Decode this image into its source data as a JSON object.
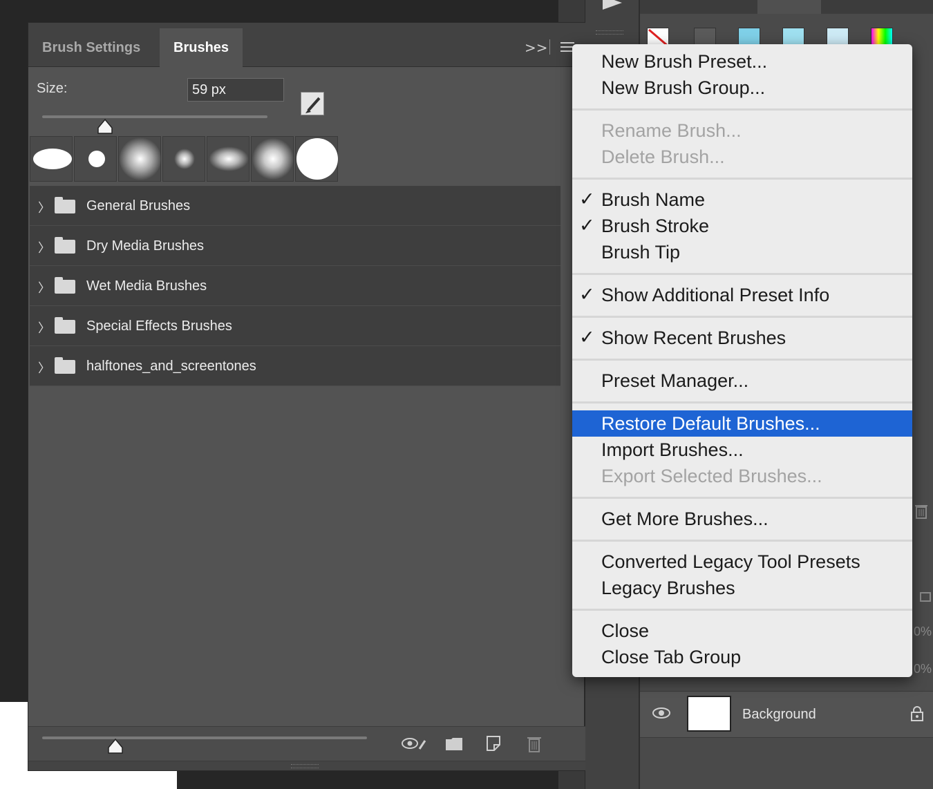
{
  "tabs": {
    "brush_settings": "Brush Settings",
    "brushes": "Brushes"
  },
  "size": {
    "label": "Size:",
    "value": "59 px",
    "slider_fraction": 0.28
  },
  "groups": [
    {
      "label": "General Brushes"
    },
    {
      "label": "Dry Media Brushes"
    },
    {
      "label": "Wet Media Brushes"
    },
    {
      "label": "Special Effects Brushes"
    },
    {
      "label": "halftones_and_screentones"
    }
  ],
  "menu": {
    "new_brush_preset": "New Brush Preset...",
    "new_brush_group": "New Brush Group...",
    "rename_brush": "Rename Brush...",
    "delete_brush": "Delete Brush...",
    "brush_name": "Brush Name",
    "brush_stroke": "Brush Stroke",
    "brush_tip": "Brush Tip",
    "show_additional_preset_info": "Show Additional Preset Info",
    "show_recent_brushes": "Show Recent Brushes",
    "preset_manager": "Preset Manager...",
    "restore_default_brushes": "Restore Default Brushes...",
    "import_brushes": "Import Brushes...",
    "export_selected_brushes": "Export Selected Brushes...",
    "get_more_brushes": "Get More Brushes...",
    "converted_legacy_tool_presets": "Converted Legacy Tool Presets",
    "legacy_brushes": "Legacy Brushes",
    "close": "Close",
    "close_tab_group": "Close Tab Group",
    "checkmark": "✓"
  },
  "layers": {
    "background_label": "Background",
    "opacity_fragment_1": "0%",
    "opacity_fragment_2": "0%"
  },
  "colors": {
    "highlight": "#1e64d4",
    "panel_bg": "#535353",
    "menu_bg": "#ececec"
  }
}
